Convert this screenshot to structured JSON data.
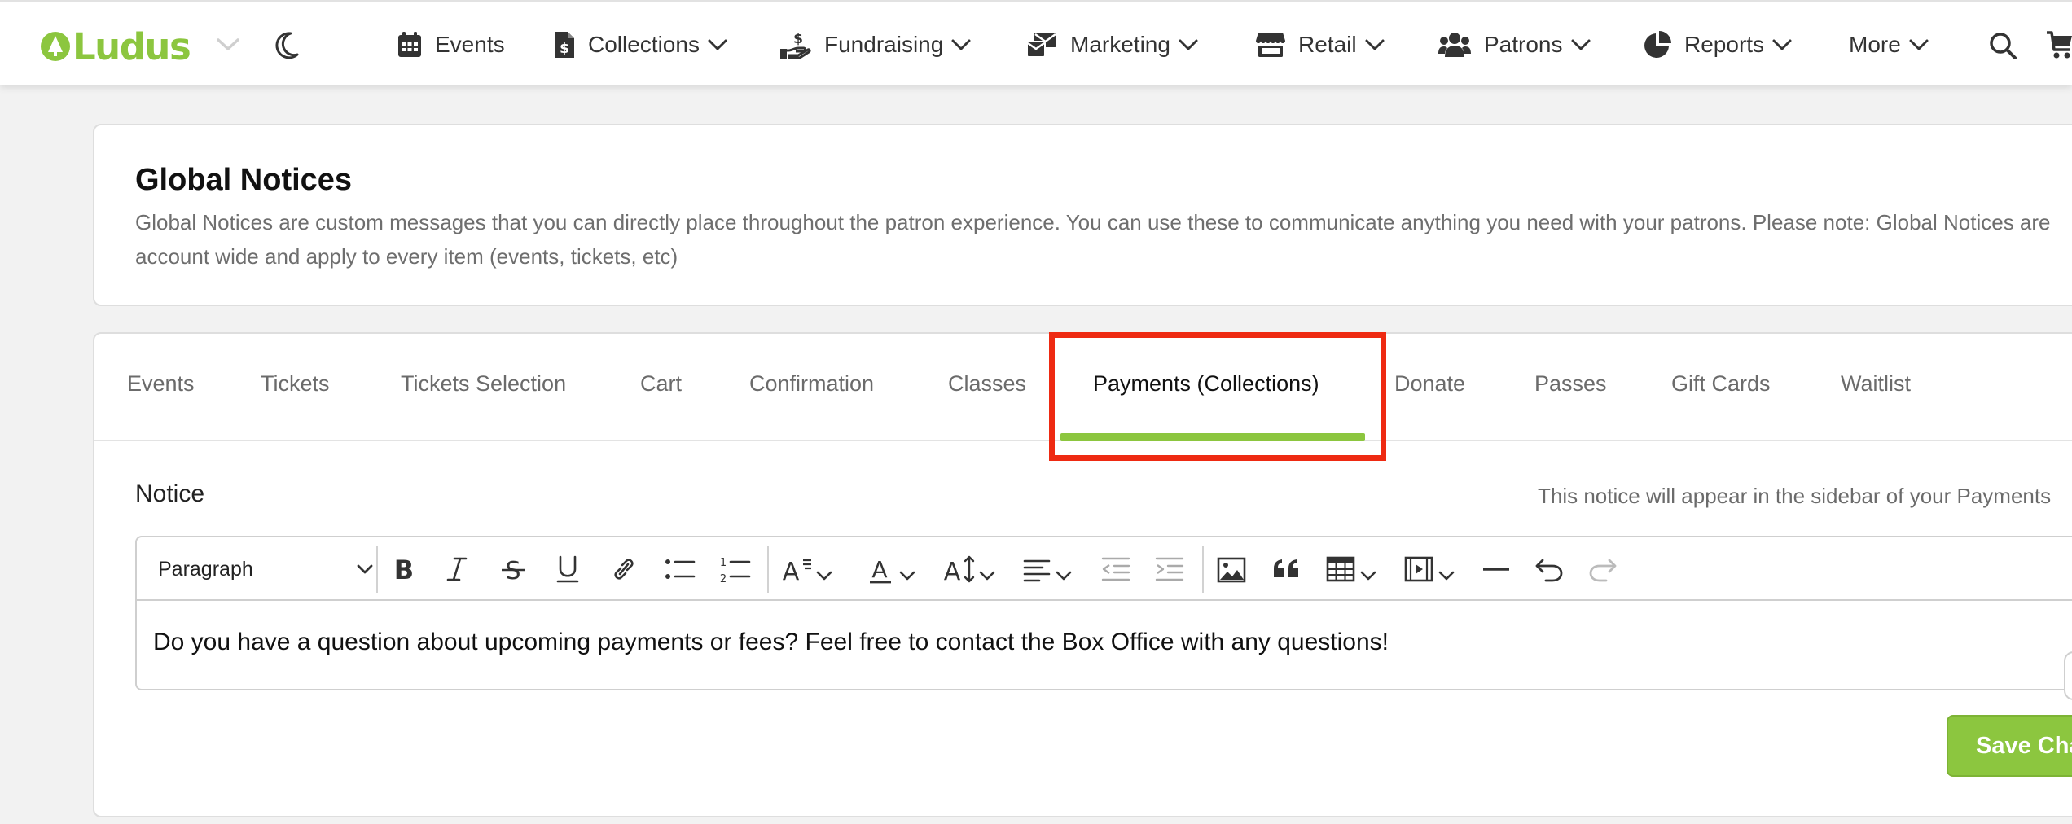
{
  "brand": {
    "name": "Ludus",
    "accent": "#8cc63f"
  },
  "nav": {
    "items": [
      {
        "label": "Events",
        "icon": "calendar-icon"
      },
      {
        "label": "Collections",
        "icon": "invoice-icon"
      },
      {
        "label": "Fundraising",
        "icon": "hand-dollar-icon"
      },
      {
        "label": "Marketing",
        "icon": "mail-bulk-icon"
      },
      {
        "label": "Retail",
        "icon": "store-icon"
      },
      {
        "label": "Patrons",
        "icon": "users-icon"
      },
      {
        "label": "Reports",
        "icon": "pie-chart-icon"
      },
      {
        "label": "More",
        "icon": ""
      }
    ]
  },
  "header": {
    "title": "Global Notices",
    "description": "Global Notices are custom messages that you can directly place throughout the patron experience. You can use these to communicate anything you need with your patrons. Please note: Global Notices are account wide and apply to every item (events, tickets, etc)"
  },
  "tabs": {
    "items": [
      "Events",
      "Tickets",
      "Tickets Selection",
      "Cart",
      "Confirmation",
      "Classes",
      "Payments (Collections)",
      "Donate",
      "Passes",
      "Gift Cards",
      "Waitlist"
    ],
    "active": "Payments (Collections)",
    "highlight_color": "#ee2a12"
  },
  "notice": {
    "label": "Notice",
    "hint": "This notice will appear in the sidebar of your Payments"
  },
  "editor": {
    "block_format": "Paragraph",
    "content": "Do you have a question about upcoming payments or fees? Feel free to contact the Box Office with any questions!",
    "tools": [
      "bold-icon",
      "italic-icon",
      "strikethrough-icon",
      "underline-icon",
      "link-icon",
      "bulleted-list-icon",
      "numbered-list-icon",
      "font-family-icon",
      "font-color-icon",
      "font-size-icon",
      "align-left-icon",
      "outdent-icon",
      "indent-icon",
      "image-icon",
      "blockquote-icon",
      "table-icon",
      "media-icon",
      "horizontal-line-icon",
      "undo-icon",
      "redo-icon"
    ]
  },
  "actions": {
    "save_label": "Save Changes"
  }
}
